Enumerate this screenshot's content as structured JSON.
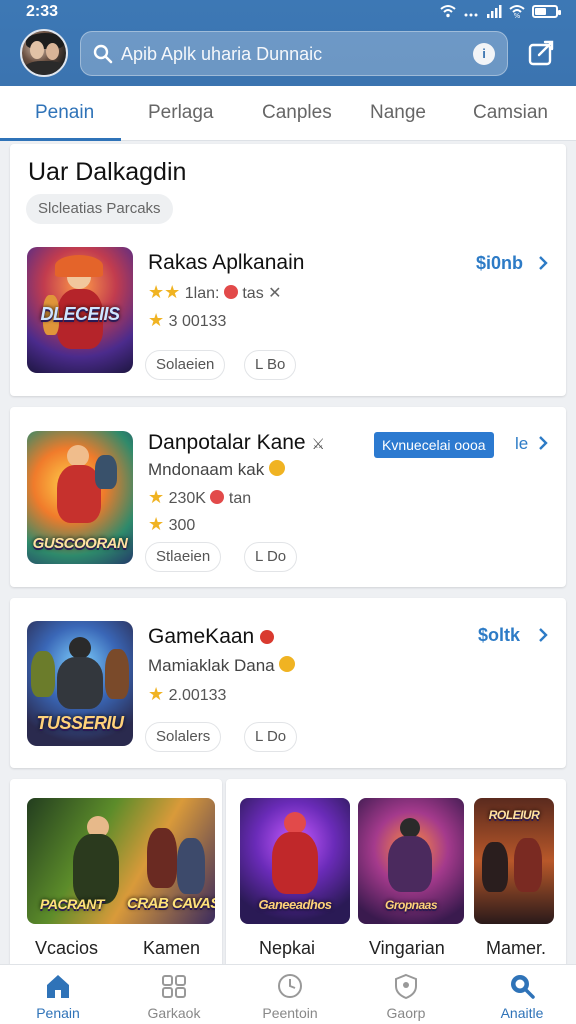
{
  "status": {
    "time": "2:33"
  },
  "search": {
    "text": "Apib Aplk uharia Dunnaic"
  },
  "tabs": [
    "Penain",
    "Perlaga",
    "Canples",
    "Nange",
    "Camsian"
  ],
  "section": {
    "title": "Uar Dalkagdin",
    "chip": "Slcleatias Parcaks"
  },
  "apps": [
    {
      "title": "Rakas Aplkanain",
      "rating_line": "1lan:",
      "rating_extra": "tas",
      "rating_line2": "3 00133",
      "tags": [
        "Solaeien",
        "L Bo"
      ],
      "price": "$i0nb",
      "thumb_text": "DLECEIIS"
    },
    {
      "title": "Danpotalar Kane",
      "subtitle": "Mndonaam kak",
      "rating_line": "230K",
      "rating_extra": "tan",
      "rating_line2": "300",
      "tags": [
        "Stlaeien",
        "L Do"
      ],
      "install_label": "Kvnuecelai oooa",
      "price_suffix": "le",
      "thumb_text": "GUSCOORAN"
    },
    {
      "title": "GameKaan",
      "subtitle": "Mamiaklak Dana",
      "rating_line": "2.00133",
      "tags": [
        "Solalers",
        "L Do"
      ],
      "price": "$oltk",
      "thumb_text": "TUSSERIU"
    }
  ],
  "grid": [
    {
      "label": "Vcacios",
      "thumb_text": "PACRANT"
    },
    {
      "label": "Kamen",
      "thumb_text": "CRAB CAVAS"
    },
    {
      "label": "Nepkai",
      "thumb_text": "Ganeeadhos"
    },
    {
      "label": "Vingarian",
      "thumb_text": "Gropnaas"
    },
    {
      "label": "Mamer.",
      "thumb_text": "ROLEIUR"
    }
  ],
  "bottom_nav": [
    {
      "label": "Penain",
      "icon": "home-icon"
    },
    {
      "label": "Garkaok",
      "icon": "apps-icon"
    },
    {
      "label": "Peentoin",
      "icon": "clock-icon"
    },
    {
      "label": "Gaorp",
      "icon": "shield-icon"
    },
    {
      "label": "Anaitle",
      "icon": "search-icon"
    }
  ],
  "colors": {
    "header": "#3b74b0",
    "accent": "#2f73b8",
    "price": "#2d7bc6",
    "star": "#f0b322"
  }
}
